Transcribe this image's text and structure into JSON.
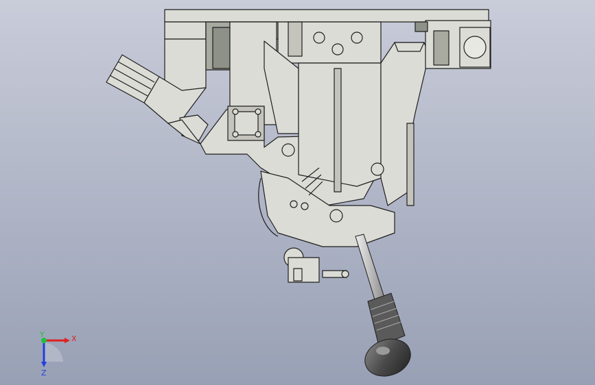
{
  "viewport": {
    "background_top": "#c9ccd9",
    "background_bottom": "#98a0b5"
  },
  "model": {
    "part_fill": "#dcdcd6",
    "part_shade": "#c4c4bd",
    "edge_color": "#1e1e1e",
    "handle_dark": "#4a4a4a"
  },
  "triad": {
    "x_label": "X",
    "y_label": "Y",
    "z_label": "Z",
    "x_color": "#e02020",
    "y_color": "#20c040",
    "z_color": "#2040e0"
  }
}
